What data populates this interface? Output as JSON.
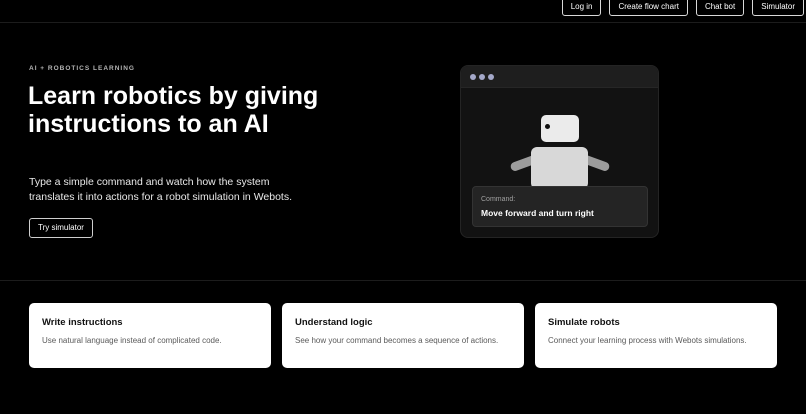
{
  "nav": {
    "items": [
      "Log in",
      "Create flow chart",
      "Chat bot",
      "Simulator"
    ]
  },
  "hero": {
    "eyebrow": "AI + ROBOTICS LEARNING",
    "title": "Learn robotics by giving instructions to an AI",
    "description": "Type a simple command and watch how the system translates it into actions for a robot simulation in Webots.",
    "cta_label": "Try simulator"
  },
  "preview": {
    "command_label": "Command:",
    "command_value": "Move forward and turn right",
    "window_dot_color": "#a4a8c9"
  },
  "features": [
    {
      "title": "Write instructions",
      "text": "Use natural language instead of complicated code."
    },
    {
      "title": "Understand logic",
      "text": "See how your command becomes a sequence of actions."
    },
    {
      "title": "Simulate robots",
      "text": "Connect your learning process with Webots simulations."
    }
  ],
  "colors": {
    "background": "#000000",
    "card_background": "#ffffff",
    "window_background": "#121212"
  }
}
